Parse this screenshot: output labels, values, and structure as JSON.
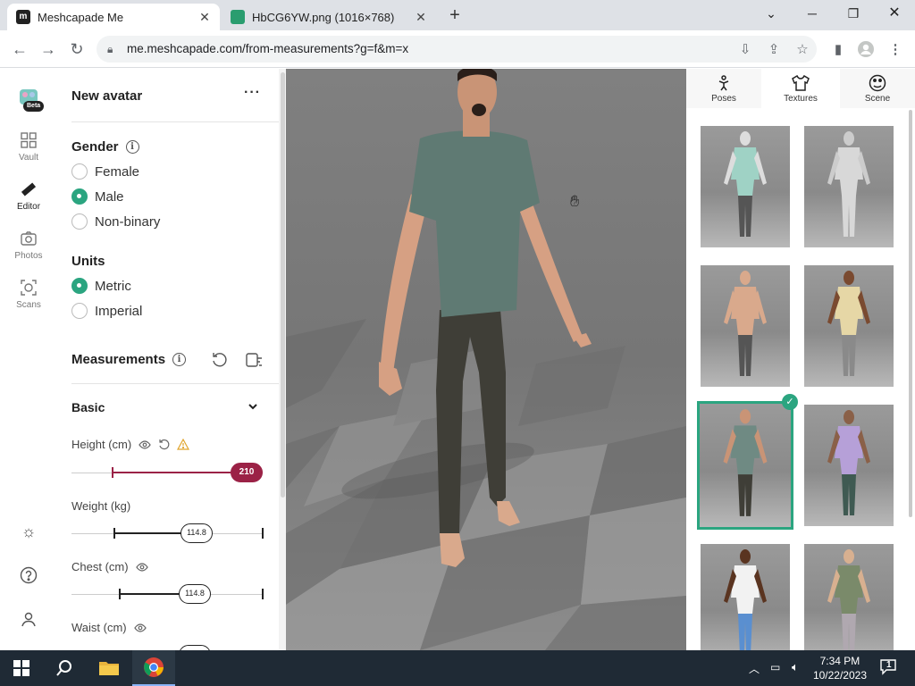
{
  "browser": {
    "tabs": [
      {
        "title": "Meshcapade Me",
        "active": true
      },
      {
        "title": "HbCG6YW.png (1016×768)",
        "active": false
      }
    ],
    "url": "me.meshcapade.com/from-measurements?g=f&m=x",
    "new_tab_symbol": "+"
  },
  "rail": {
    "badge": "Beta",
    "items": [
      {
        "label": "Vault",
        "icon": "grid-icon"
      },
      {
        "label": "Editor",
        "icon": "ruler-icon"
      },
      {
        "label": "Photos",
        "icon": "camera-icon"
      },
      {
        "label": "Scans",
        "icon": "scan-icon"
      }
    ]
  },
  "panel": {
    "title": "New avatar",
    "menu": "···",
    "gender": {
      "heading": "Gender",
      "options": [
        "Female",
        "Male",
        "Non-binary"
      ],
      "selected": "Male"
    },
    "units": {
      "heading": "Units",
      "options": [
        "Metric",
        "Imperial"
      ],
      "selected": "Metric"
    },
    "measurements_heading": "Measurements",
    "basic_heading": "Basic",
    "measures": [
      {
        "label": "Height (cm)",
        "value": "210",
        "fraction": 1.0
      },
      {
        "label": "Weight (kg)",
        "value": "114.8",
        "fraction": 0.43
      },
      {
        "label": "Chest (cm)",
        "value": "114.8",
        "fraction": 0.51
      },
      {
        "label": "Waist (cm)",
        "value": "",
        "fraction": 0.5
      }
    ]
  },
  "right_panel": {
    "tabs": [
      {
        "label": "Poses",
        "icon": "pose-icon"
      },
      {
        "label": "Textures",
        "icon": "tshirt-icon"
      },
      {
        "label": "Scene",
        "icon": "palette-icon"
      }
    ],
    "active_tab": "Textures",
    "selected_texture_index": 4,
    "texture_count": 8
  },
  "taskbar": {
    "time": "7:34 PM",
    "date": "10/22/2023",
    "notification_count": "1"
  },
  "colors": {
    "accent": "#2ba580",
    "height_slider": "#9b2246",
    "taskbar": "#1f2a35"
  }
}
